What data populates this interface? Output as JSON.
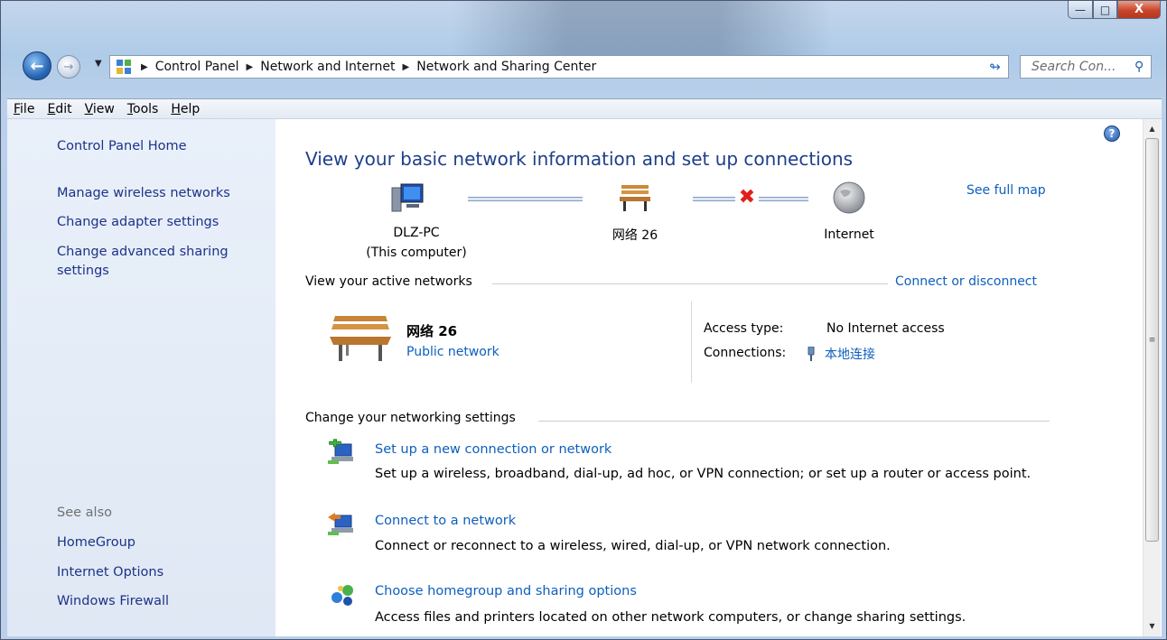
{
  "window": {
    "caption_buttons": {
      "minimize": "—",
      "maximize": "□",
      "close": "X"
    }
  },
  "nav": {
    "back_icon": "back-arrow-icon",
    "forward_icon": "forward-arrow-icon",
    "breadcrumbs": [
      "Control Panel",
      "Network and Internet",
      "Network and Sharing Center"
    ],
    "search_placeholder": "Search Con..."
  },
  "menu": [
    "File",
    "Edit",
    "View",
    "Tools",
    "Help"
  ],
  "sidebar": {
    "home": "Control Panel Home",
    "links": [
      "Manage wireless networks",
      "Change adapter settings",
      "Change advanced sharing",
      "settings"
    ],
    "see_also_label": "See also",
    "see_also": [
      "HomeGroup",
      "Internet Options",
      "Windows Firewall"
    ]
  },
  "main": {
    "title": "View your basic network information and set up connections",
    "see_full_map": "See full map",
    "map": {
      "computer_name": "DLZ-PC",
      "computer_sub": "(This computer)",
      "network_name": "网络 26",
      "internet_label": "Internet"
    },
    "active_networks_heading": "View your active networks",
    "connect_or_disconnect": "Connect or disconnect",
    "active": {
      "name": "网络 26",
      "type": "Public network",
      "access_type_label": "Access type:",
      "access_type_value": "No Internet access",
      "connections_label": "Connections:",
      "connections_value": "本地连接"
    },
    "change_settings_heading": "Change your networking settings",
    "tasks": [
      {
        "title": "Set up a new connection or network",
        "desc": "Set up a wireless, broadband, dial-up, ad hoc, or VPN connection; or set up a router or access point."
      },
      {
        "title": "Connect to a network",
        "desc": "Connect or reconnect to a wireless, wired, dial-up, or VPN network connection."
      },
      {
        "title": "Choose homegroup and sharing options",
        "desc": "Access files and printers located on other network computers, or change sharing settings."
      }
    ]
  },
  "help_glyph": "?",
  "colors": {
    "link": "#0d5fbd",
    "title": "#1e3f8a",
    "sidebar_link": "#1e3287",
    "error_x": "#e0201b"
  }
}
